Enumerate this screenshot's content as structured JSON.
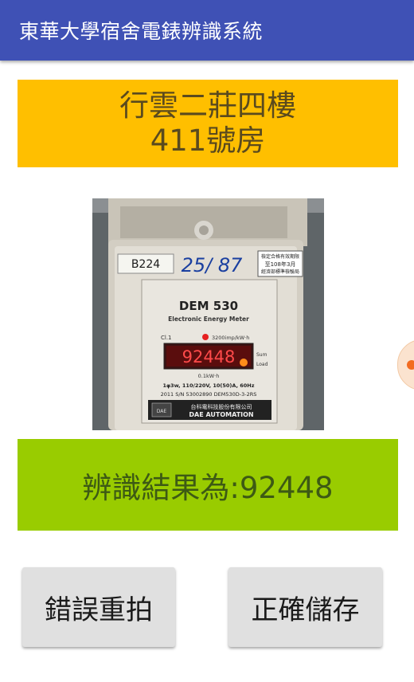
{
  "app": {
    "title": "東華大學宿舍電錶辨識系統"
  },
  "room": {
    "building": "行雲二莊四樓",
    "room_number": "411號房"
  },
  "meter_photo": {
    "label_tag": "B224",
    "handwritten": "25/ 87",
    "sticker_line1": "檢定合格有效期限",
    "sticker_line2": "至108年3月",
    "sticker_line3": "經濟部標準檢驗局",
    "model": "DEM 530",
    "subtitle": "Electronic Energy Meter",
    "class_label": "Cl.1",
    "pulse_rate": "3200imp/kW·h",
    "display_value": "92448",
    "side_label_1": "Sum",
    "side_label_2": "Load",
    "resolution": "0.1kW·h",
    "spec": "1φ3w, 110/220V, 10(50)A, 60Hz",
    "serial": "2011 S/N 53002890  DEM530D-3-2RS",
    "maker_cn": "台科電科技股份有限公司",
    "maker_en": "DAE AUTOMATION",
    "maker_logo": "DAE"
  },
  "result": {
    "text": "辨識結果為:92448"
  },
  "actions": {
    "retake_label": "錯誤重拍",
    "save_label": "正確儲存"
  },
  "colors": {
    "appbar": "#3f51b5",
    "room_banner": "#ffbf00",
    "result_banner": "#99cc00",
    "button": "#e0e0e0",
    "side_tab_accent": "#f26b21"
  }
}
